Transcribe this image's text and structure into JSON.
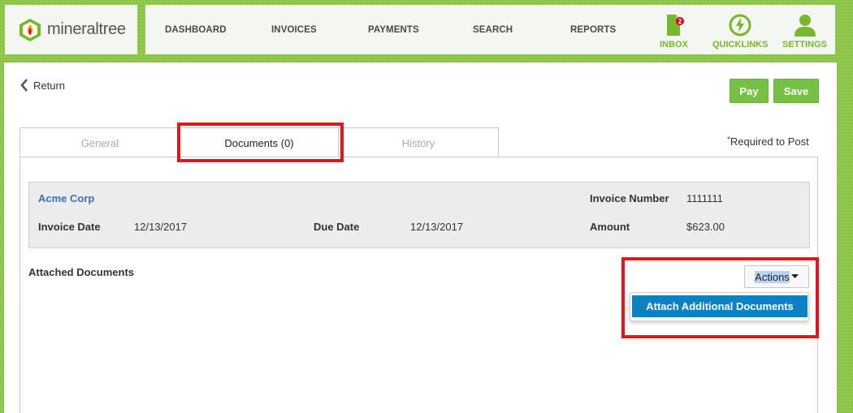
{
  "header": {
    "logo_text": "mineraltree",
    "nav": [
      "DASHBOARD",
      "INVOICES",
      "PAYMENTS",
      "SEARCH",
      "REPORTS"
    ],
    "icons": [
      {
        "label": "INBOX",
        "icon": "inbox-icon",
        "badge": "2"
      },
      {
        "label": "QUICKLINKS",
        "icon": "lightning-icon"
      },
      {
        "label": "SETTINGS",
        "icon": "user-icon"
      }
    ]
  },
  "toolbar": {
    "return_label": "Return",
    "pay_label": "Pay",
    "save_label": "Save"
  },
  "tabs": [
    "General",
    "Documents (0)",
    "History"
  ],
  "required_note": "Required to Post",
  "invoice": {
    "vendor": "Acme Corp",
    "invoice_number_label": "Invoice Number",
    "invoice_number": "1111111",
    "invoice_date_label": "Invoice Date",
    "invoice_date": "12/13/2017",
    "due_date_label": "Due Date",
    "due_date": "12/13/2017",
    "amount_label": "Amount",
    "amount": "$623.00"
  },
  "documents": {
    "heading": "Attached Documents",
    "actions_label": "Actions",
    "menu_items": [
      "Attach Additional Documents"
    ]
  },
  "colors": {
    "brand_green": "#76c043",
    "link_blue": "#3d6fb6",
    "menu_blue": "#0b82c4",
    "highlight_red": "#e8141b"
  }
}
